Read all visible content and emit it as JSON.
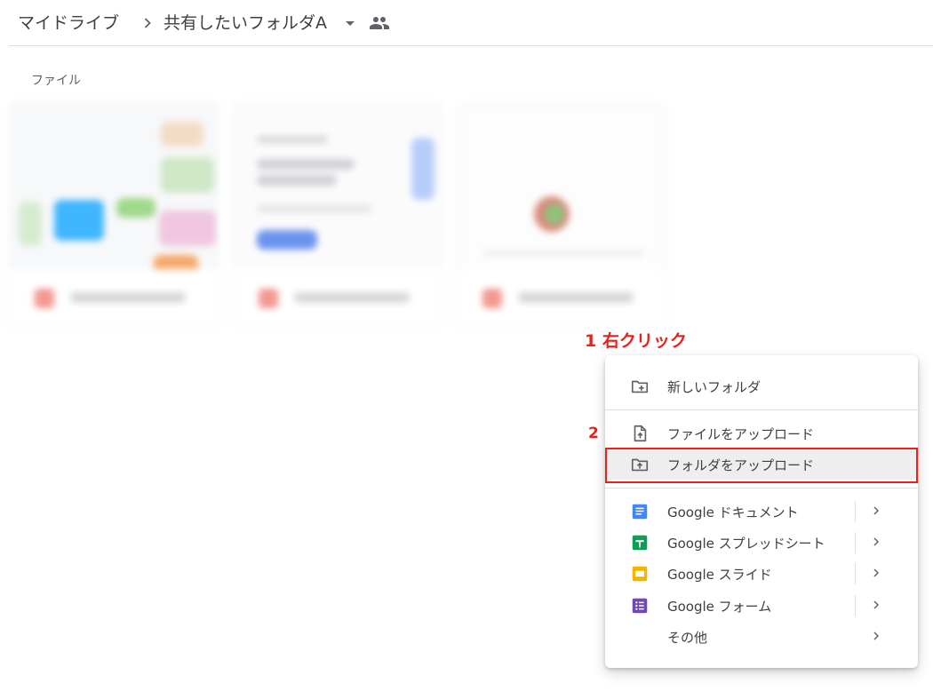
{
  "breadcrumb": {
    "root": "マイドライブ",
    "current": "共有したいフォルダA"
  },
  "section": {
    "files_label": "ファイル"
  },
  "annotations": {
    "step1": "1 右クリック",
    "step2": "2"
  },
  "context_menu": {
    "new_folder": "新しいフォルダ",
    "upload_file": "ファイルをアップロード",
    "upload_folder": "フォルダをアップロード",
    "google_docs": "Google ドキュメント",
    "google_sheets": "Google スプレッドシート",
    "google_slides": "Google スライド",
    "google_forms": "Google フォーム",
    "more": "その他"
  },
  "colors": {
    "annotation_red": "#e8211b",
    "docs_blue": "#4285f4",
    "sheets_green": "#0f9d58",
    "slides_yellow": "#f4b400",
    "forms_purple": "#7248b9"
  }
}
